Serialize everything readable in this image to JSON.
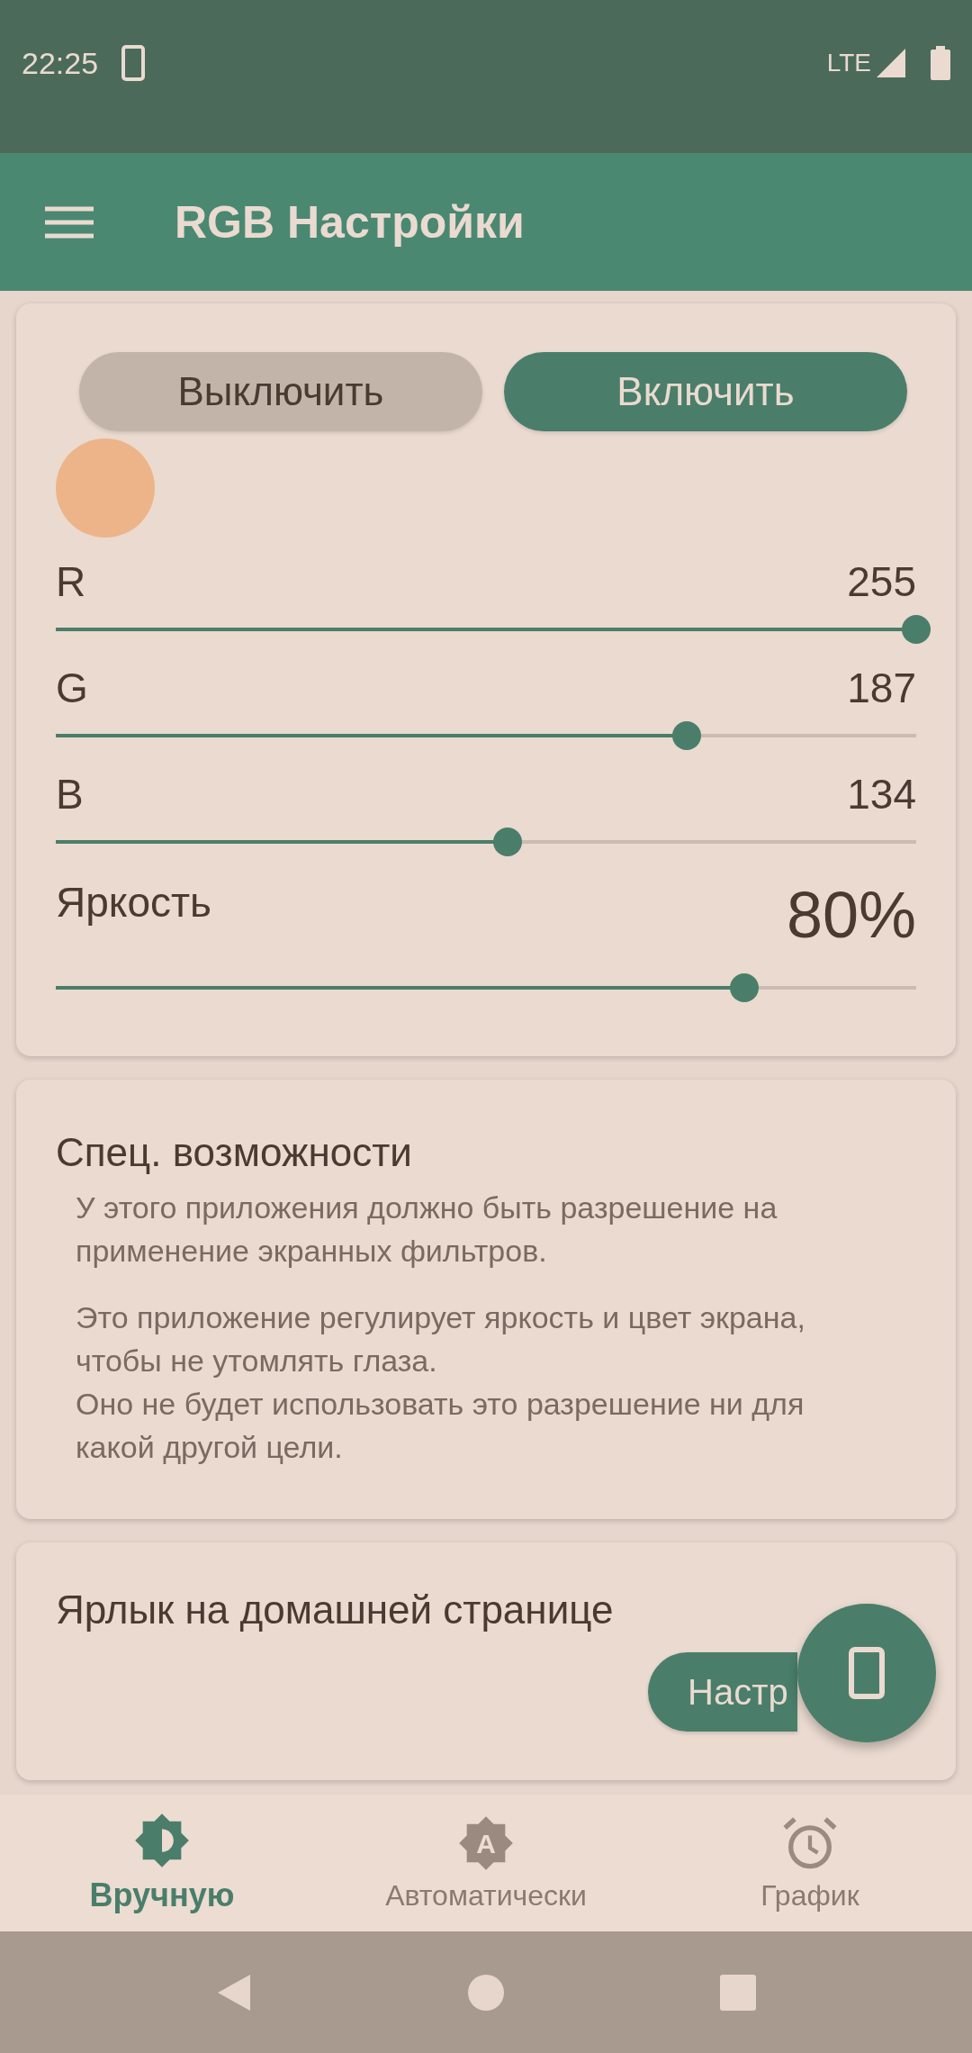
{
  "status_bar": {
    "time": "22:25",
    "network": "LTE"
  },
  "app_bar": {
    "title": "RGB Настройки"
  },
  "power_buttons": [
    {
      "label": "Выключить",
      "selected": false
    },
    {
      "label": "Включить",
      "selected": true
    }
  ],
  "color_preview": {
    "color": "#edb48a"
  },
  "sliders": [
    {
      "label": "R",
      "reading": "255",
      "level": 1.0,
      "kind": "channel"
    },
    {
      "label": "G",
      "reading": "187",
      "level": 0.733,
      "kind": "channel"
    },
    {
      "label": "B",
      "reading": "134",
      "level": 0.525,
      "kind": "channel"
    },
    {
      "label": "Яркость",
      "reading": "80%",
      "level": 0.8,
      "kind": "brightness"
    }
  ],
  "accessibility_card": {
    "title": "Спец. возможности",
    "paragraphs": [
      "У этого приложения должно быть разрешение на применение экранных фильтров.",
      "Это приложение регулирует яркость и цвет экрана, чтобы не утомлять глаза.\nОно не будет использовать это разрешение ни для какой другой цели."
    ]
  },
  "shortcut_card": {
    "title": "Ярлык на домашней странице",
    "button": "Настр"
  },
  "bottom_nav": [
    {
      "label": "Вручную",
      "kind": "manual",
      "selected": true
    },
    {
      "label": "Автоматически",
      "kind": "auto",
      "icon_letter": "A",
      "selected": false
    },
    {
      "label": "График",
      "kind": "schedule",
      "selected": false
    }
  ]
}
